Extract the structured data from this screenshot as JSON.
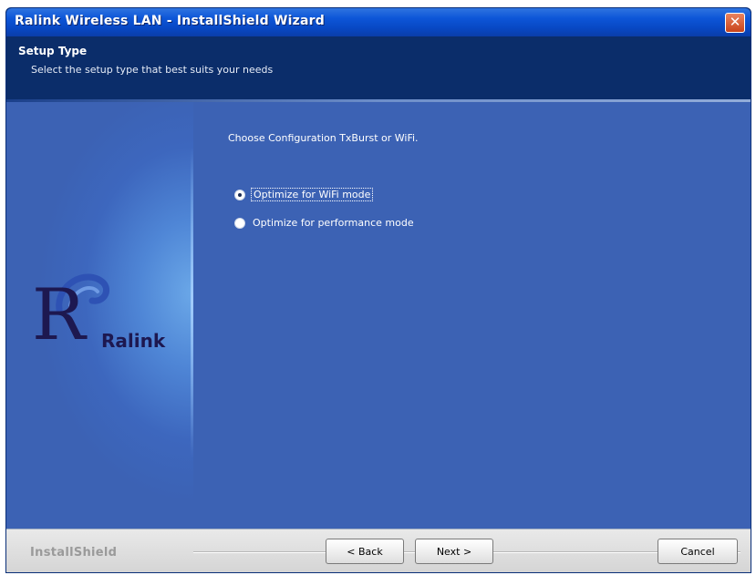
{
  "window": {
    "title": "Ralink Wireless LAN - InstallShield Wizard",
    "close_symbol": "✕",
    "close_icon": "close-icon"
  },
  "header": {
    "title": "Setup Type",
    "subtitle": "Select the setup type that best suits your needs"
  },
  "side_panel": {
    "logo_text": "Ralink",
    "logo_letter": "R"
  },
  "main": {
    "prompt": "Choose Configuration TxBurst or WiFi.",
    "options": [
      {
        "label": "Optimize for WiFi mode",
        "selected": true
      },
      {
        "label": "Optimize for performance mode",
        "selected": false
      }
    ]
  },
  "footer": {
    "brand": "InstallShield",
    "back_label": "< Back",
    "next_label": "Next >",
    "cancel_label": "Cancel"
  },
  "colors": {
    "title_bar": "#0d56d8",
    "header_bg": "#0b2d6a",
    "content_bg": "#3c62b4",
    "logo_color": "#1d1850",
    "close_button": "#c9431a"
  }
}
